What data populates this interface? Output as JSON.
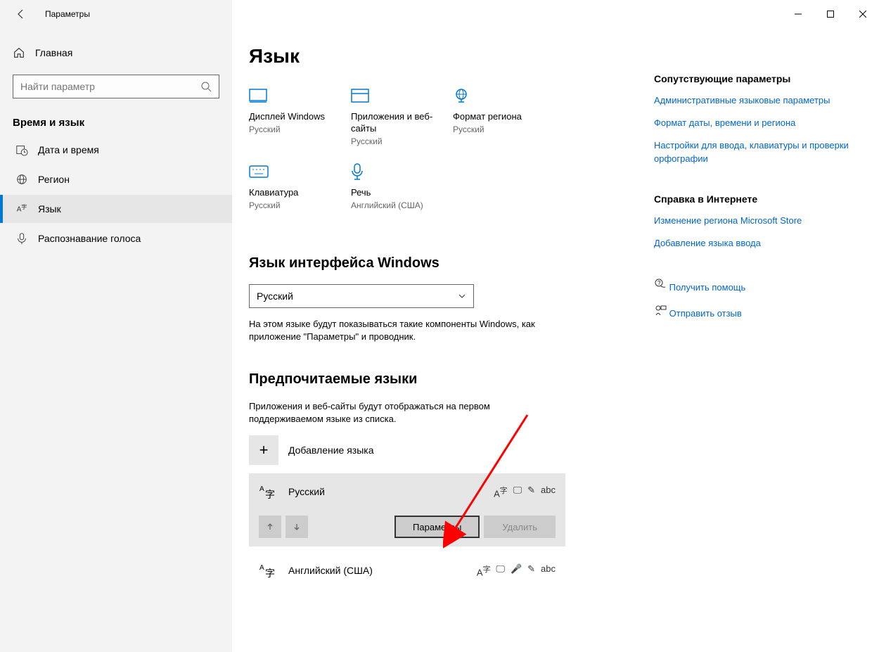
{
  "titlebar": {
    "title": "Параметры"
  },
  "sidebar": {
    "home": "Главная",
    "search_placeholder": "Найти параметр",
    "section": "Время и язык",
    "items": [
      {
        "label": "Дата и время"
      },
      {
        "label": "Регион"
      },
      {
        "label": "Язык"
      },
      {
        "label": "Распознавание голоса"
      }
    ]
  },
  "main": {
    "heading": "Язык",
    "tiles": [
      {
        "title": "Дисплей Windows",
        "sub": "Русский"
      },
      {
        "title": "Приложения и веб-сайты",
        "sub": "Русский"
      },
      {
        "title": "Формат региона",
        "sub": "Русский"
      },
      {
        "title": "Клавиатура",
        "sub": "Русский"
      },
      {
        "title": "Речь",
        "sub": "Английский (США)"
      }
    ],
    "display_lang_heading": "Язык интерфейса Windows",
    "display_lang_value": "Русский",
    "display_lang_desc": "На этом языке будут показываться такие компоненты Windows, как приложение \"Параметры\" и проводник.",
    "pref_heading": "Предпочитаемые языки",
    "pref_desc": "Приложения и веб-сайты будут отображаться на первом поддерживаемом языке из списка.",
    "add_lang": "Добавление языка",
    "langs": [
      {
        "name": "Русский"
      },
      {
        "name": "Английский (США)"
      }
    ],
    "btn_options": "Параметры",
    "btn_remove": "Удалить"
  },
  "aside": {
    "related_heading": "Сопутствующие параметры",
    "related": [
      "Административные языковые параметры",
      "Формат даты, времени и региона",
      "Настройки для ввода, клавиатуры и проверки орфографии"
    ],
    "help_heading": "Справка в Интернете",
    "help": [
      "Изменение региона Microsoft Store",
      "Добавление языка ввода"
    ],
    "get_help": "Получить помощь",
    "feedback": "Отправить отзыв"
  }
}
